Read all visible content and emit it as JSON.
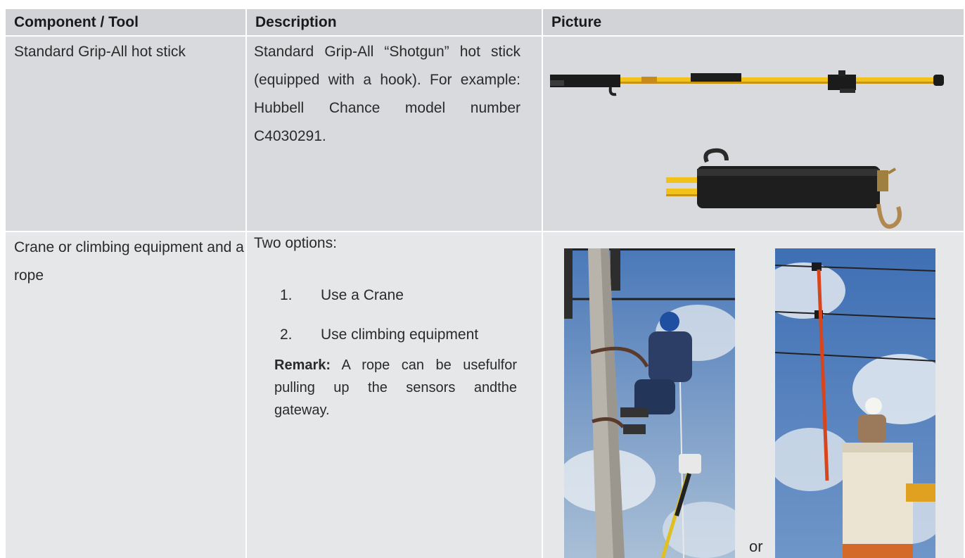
{
  "table": {
    "headers": [
      "Component / Tool",
      "Description",
      "Picture"
    ],
    "rows": [
      {
        "component": "Standard Grip-All hot stick",
        "description": "Standard Grip-All “Shotgun” hot stick (equipped with a hook). For example: Hubbell Chance model number C4030291."
      },
      {
        "component": "Crane or climbing equipment and a rope",
        "description_intro": "Two options:",
        "options": [
          {
            "number": "1.",
            "text": "Use a Crane"
          },
          {
            "number": "2.",
            "text": "Use climbing equipment"
          }
        ],
        "remark_label": "Remark:",
        "remark_text": " A rope can be usefulfor pulling up the sensors andthe gateway.",
        "picture_separator": "or"
      }
    ]
  },
  "colors": {
    "header_bg": "#d2d3d6",
    "row1_bg": "#d9dadd",
    "row2_bg": "#e6e7e9",
    "stick_yellow": "#f2c21a",
    "sky_blue": "#5b86c2"
  }
}
